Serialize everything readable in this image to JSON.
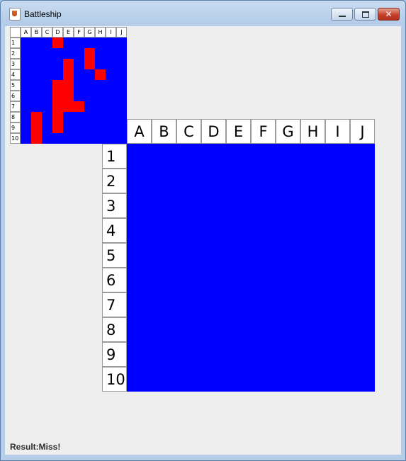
{
  "window": {
    "title": "Battleship",
    "icon": "java-coffee-icon"
  },
  "columns": [
    "A",
    "B",
    "C",
    "D",
    "E",
    "F",
    "G",
    "H",
    "I",
    "J"
  ],
  "rows": [
    "1",
    "2",
    "3",
    "4",
    "5",
    "6",
    "7",
    "8",
    "9",
    "10"
  ],
  "own_board": {
    "water_color": "#0000ff",
    "ship_color": "#ff0000",
    "ship_cells": [
      [
        1,
        4
      ],
      [
        2,
        7
      ],
      [
        3,
        5
      ],
      [
        3,
        7
      ],
      [
        4,
        5
      ],
      [
        4,
        8
      ],
      [
        5,
        4
      ],
      [
        5,
        5
      ],
      [
        6,
        4
      ],
      [
        6,
        5
      ],
      [
        7,
        4
      ],
      [
        7,
        5
      ],
      [
        7,
        6
      ],
      [
        8,
        2
      ],
      [
        8,
        4
      ],
      [
        9,
        2
      ],
      [
        9,
        4
      ],
      [
        10,
        2
      ]
    ]
  },
  "target_board": {
    "water_color": "#0000ff"
  },
  "status": {
    "result_text": "Result:Miss!"
  }
}
